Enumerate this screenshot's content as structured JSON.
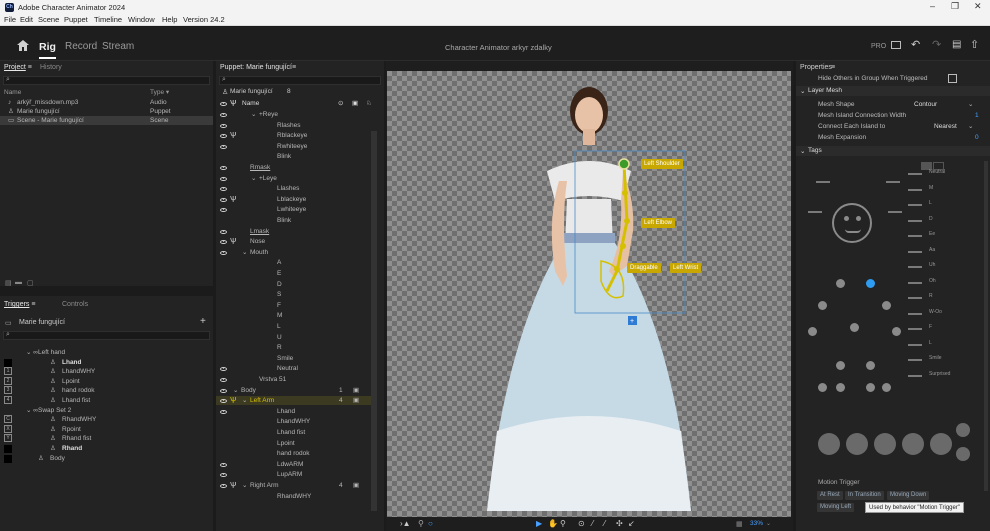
{
  "app": {
    "title": "Adobe Character Animator 2024",
    "logo": "Ch"
  },
  "menu": [
    "File",
    "Edit",
    "Scene",
    "Puppet",
    "Timeline",
    "Window",
    "Help",
    "Version 24.2"
  ],
  "modes": [
    "Rig",
    "Record",
    "Stream"
  ],
  "doc_title": "Character Animator arkyr zdalky",
  "pro_label": "PRO",
  "project": {
    "tabs": [
      "Project",
      "History"
    ],
    "columns": [
      "Name",
      "Type ▾"
    ],
    "items": [
      {
        "name": "arkýř_missdown.mp3",
        "type": "Audio"
      },
      {
        "name": "Marie fungující",
        "type": "Puppet"
      },
      {
        "name": "Scene - Marie fungující",
        "type": "Scene"
      }
    ]
  },
  "triggers": {
    "tabs": [
      "Triggers",
      "Controls"
    ],
    "puppet": "Marie fungující",
    "add": "+",
    "items": [
      {
        "label": "Left hand",
        "indent": 1,
        "key": "",
        "swatch": ""
      },
      {
        "label": "Lhand",
        "indent": 3,
        "key": "",
        "swatch": "#000000",
        "bold": true
      },
      {
        "label": "LhandWHY",
        "indent": 3,
        "key": "1",
        "swatch": ""
      },
      {
        "label": "Lpoint",
        "indent": 3,
        "key": "2",
        "swatch": ""
      },
      {
        "label": "hand rodok",
        "indent": 3,
        "key": "3",
        "swatch": ""
      },
      {
        "label": "Lhand fist",
        "indent": 3,
        "key": "4",
        "swatch": ""
      },
      {
        "label": "Swap Set 2",
        "indent": 1,
        "key": "",
        "swatch": ""
      },
      {
        "label": "RhandWHY",
        "indent": 3,
        "key": "C",
        "swatch": ""
      },
      {
        "label": "Rpoint",
        "indent": 3,
        "key": "X",
        "swatch": ""
      },
      {
        "label": "Rhand fist",
        "indent": 3,
        "key": "Y",
        "swatch": ""
      },
      {
        "label": "Rhand",
        "indent": 3,
        "key": "",
        "swatch": "#000000",
        "bold": true
      },
      {
        "label": "Body",
        "indent": 2,
        "key": "",
        "swatch": "#000000"
      }
    ]
  },
  "puppet": {
    "tab": "Puppet: Marie fungující",
    "name": "Marie fungující",
    "count": "8",
    "col_name": "Name",
    "layers": [
      {
        "label": "+Reye",
        "indent": 3,
        "eye": true,
        "warp": false,
        "chev": true
      },
      {
        "label": "Rlashes",
        "indent": 5,
        "eye": true,
        "warp": false
      },
      {
        "label": "Rblackeye",
        "indent": 5,
        "eye": true,
        "warp": true
      },
      {
        "label": "Rwhiteeye",
        "indent": 5,
        "eye": true,
        "warp": false
      },
      {
        "label": "Blink",
        "indent": 5,
        "eye": false,
        "warp": false
      },
      {
        "label": "Rmask",
        "indent": 2,
        "eye": true,
        "warp": false,
        "u": true
      },
      {
        "label": "+Leye",
        "indent": 3,
        "eye": true,
        "warp": false,
        "chev": true
      },
      {
        "label": "Llashes",
        "indent": 5,
        "eye": true,
        "warp": false
      },
      {
        "label": "Lblackeye",
        "indent": 5,
        "eye": true,
        "warp": true
      },
      {
        "label": "Lwhiteeye",
        "indent": 5,
        "eye": true,
        "warp": false
      },
      {
        "label": "Blink",
        "indent": 5,
        "eye": false,
        "warp": false
      },
      {
        "label": "Lmask",
        "indent": 2,
        "eye": true,
        "warp": false,
        "u": true
      },
      {
        "label": "Nose",
        "indent": 2,
        "eye": true,
        "warp": true
      },
      {
        "label": "Mouth",
        "indent": 2,
        "eye": true,
        "warp": false,
        "chev": true
      },
      {
        "label": "A",
        "indent": 5,
        "eye": false,
        "warp": false
      },
      {
        "label": "E",
        "indent": 5,
        "eye": false,
        "warp": false
      },
      {
        "label": "D",
        "indent": 5,
        "eye": false,
        "warp": false
      },
      {
        "label": "S",
        "indent": 5,
        "eye": false,
        "warp": false
      },
      {
        "label": "F",
        "indent": 5,
        "eye": false,
        "warp": false
      },
      {
        "label": "M",
        "indent": 5,
        "eye": false,
        "warp": false
      },
      {
        "label": "L",
        "indent": 5,
        "eye": false,
        "warp": false
      },
      {
        "label": "U",
        "indent": 5,
        "eye": false,
        "warp": false
      },
      {
        "label": "R",
        "indent": 5,
        "eye": false,
        "warp": false
      },
      {
        "label": "Smile",
        "indent": 5,
        "eye": false,
        "warp": false
      },
      {
        "label": "Neutral",
        "indent": 5,
        "eye": true,
        "warp": false
      },
      {
        "label": "Vrstva 51",
        "indent": 3,
        "eye": true,
        "warp": false
      },
      {
        "label": "Body",
        "indent": 1,
        "eye": true,
        "warp": false,
        "chev": true,
        "num": "1"
      },
      {
        "label": "Left Arm",
        "indent": 2,
        "eye": true,
        "warp": true,
        "chev": true,
        "num": "4",
        "sel": true
      },
      {
        "label": "Lhand",
        "indent": 5,
        "eye": true,
        "warp": false
      },
      {
        "label": "LhandWHY",
        "indent": 5,
        "eye": false,
        "warp": false
      },
      {
        "label": "Lhand fist",
        "indent": 5,
        "eye": false,
        "warp": false
      },
      {
        "label": "Lpoint",
        "indent": 5,
        "eye": false,
        "warp": false
      },
      {
        "label": "hand rodok",
        "indent": 5,
        "eye": false,
        "warp": false
      },
      {
        "label": "LdwARM",
        "indent": 5,
        "eye": true,
        "warp": false
      },
      {
        "label": "LupARM",
        "indent": 5,
        "eye": true,
        "warp": false
      },
      {
        "label": "Right Arm",
        "indent": 2,
        "eye": true,
        "warp": true,
        "chev": true,
        "num": "4"
      },
      {
        "label": "RhandWHY",
        "indent": 5,
        "eye": false,
        "warp": false
      }
    ]
  },
  "stage": {
    "handles": [
      "Left Shoulder",
      "Left Elbow",
      "Draggable",
      "Left Wrist"
    ],
    "zoom": "33%"
  },
  "properties": {
    "title": "Properties",
    "hide_others": "Hide Others in Group When Triggered",
    "layer_mesh": "Layer Mesh",
    "mesh_shape_label": "Mesh Shape",
    "mesh_shape_value": "Contour",
    "island_width_label": "Mesh Island Connection Width",
    "island_width_value": "1",
    "connect_label": "Connect Each Island to",
    "connect_value": "Nearest",
    "expansion_label": "Mesh Expansion",
    "expansion_value": "0",
    "tags_title": "Tags",
    "mouth_tags": [
      "Neutral",
      "M",
      "L",
      "D",
      "Ee",
      "Aa",
      "Uh",
      "Oh",
      "R",
      "W-Oo",
      "F",
      "L",
      "Smile",
      "Surprised"
    ],
    "motion_trigger": "Motion Trigger",
    "motion_tags": [
      "At Rest",
      "In Transition",
      "Moving Down",
      "Moving Left"
    ],
    "tooltip": "Used by behavior \"Motion Trigger\""
  }
}
